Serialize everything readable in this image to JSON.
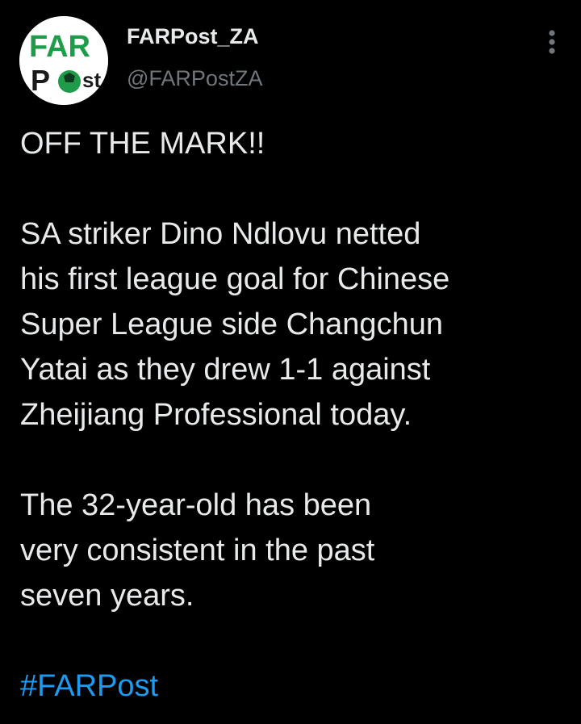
{
  "author": {
    "display_name": "FARPost_ZA",
    "handle": "@FARPostZA",
    "avatar_icon": "farpost-logo-icon",
    "avatar_logo_text": "FARPost"
  },
  "menu_icon": "more-options-icon",
  "tweet": {
    "headline": "OFF THE MARK!!",
    "paragraph_1": [
      "SA striker Dino Ndlovu netted",
      "his first league goal for Chinese",
      "Super League side Changchun",
      "Yatai as they drew 1-1 against",
      "Zheijiang Professional today."
    ],
    "paragraph_2": [
      "The 32-year-old has been",
      "very consistent in the past",
      "seven years."
    ],
    "hashtag": "#FARPost"
  },
  "colors": {
    "background": "#000000",
    "text_primary": "#e7e9ea",
    "text_secondary": "#71767b",
    "link": "#1d9bf0",
    "logo_green": "#1e9c4a",
    "logo_dark": "#1a1a1a"
  }
}
